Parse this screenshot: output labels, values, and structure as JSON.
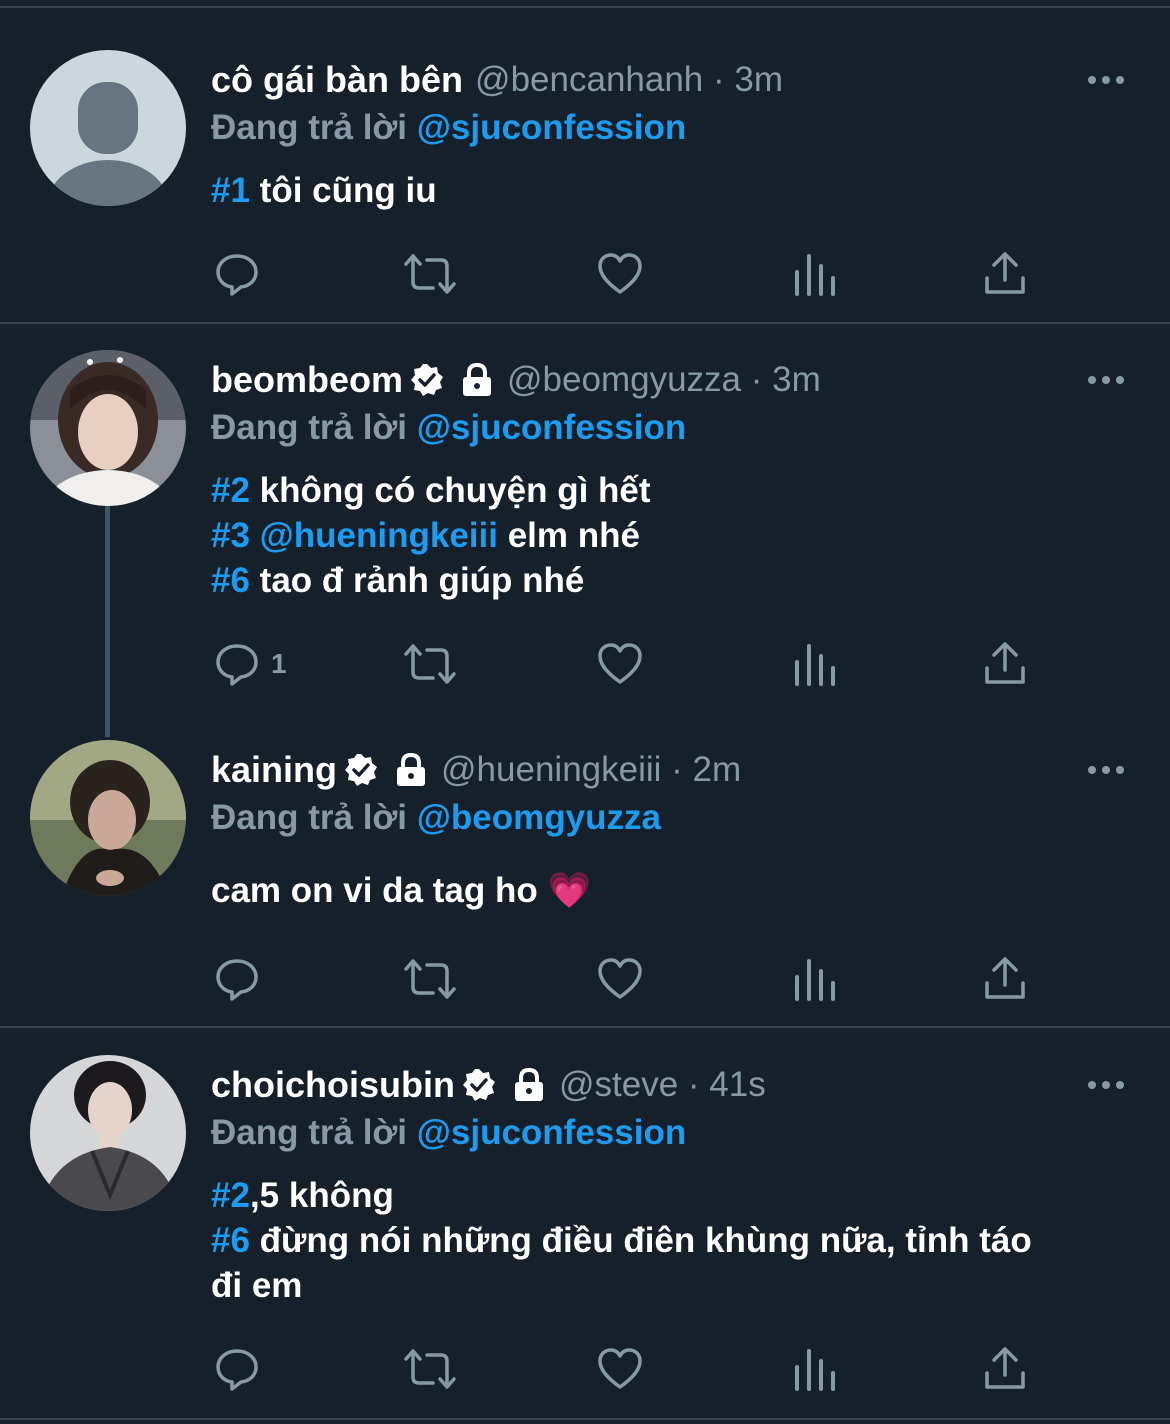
{
  "tweets": [
    {
      "name": "cô gái bàn bên",
      "handle": "@bencanhanh · 3m",
      "reply_prefix": "Đang trả lời ",
      "reply_to": "@sjuconfession",
      "lines": [
        {
          "tag": "#1",
          "text": " tôi cũng iu"
        }
      ],
      "reply_count": ""
    },
    {
      "name": "beombeom",
      "handle": "@beomgyuzza · 3m",
      "reply_prefix": "Đang trả lời ",
      "reply_to": "@sjuconfession",
      "lines": [
        {
          "tag": "#2",
          "text": " không có chuyện gì hết"
        },
        {
          "tag": "#3",
          "mention": " @hueningkeiii",
          "text": " elm nhé"
        },
        {
          "tag": "#6",
          "text": " tao đ rảnh giúp nhé"
        }
      ],
      "reply_count": "1"
    },
    {
      "name": "kaining",
      "handle": "@hueningkeiii · 2m",
      "reply_prefix": "Đang trả lời ",
      "reply_to": "@beomgyuzza",
      "lines": [
        {
          "text": "cam on vi da tag ho ",
          "emoji": "💗"
        }
      ],
      "reply_count": ""
    },
    {
      "name": "choichoisubin",
      "handle": "@steve · 41s",
      "reply_prefix": "Đang trả lời ",
      "reply_to": "@sjuconfession",
      "lines": [
        {
          "tag": "#2",
          "text": ",5 không"
        },
        {
          "tag": "#6",
          "text": " đừng nói những điều điên khùng nữa, tỉnh táo"
        },
        {
          "text": "đi em"
        }
      ],
      "reply_count": ""
    }
  ],
  "icons": {
    "reply": "reply-icon",
    "retweet": "retweet-icon",
    "like": "heart-icon",
    "analytics": "analytics-icon",
    "share": "share-icon",
    "more": "more-icon",
    "verified": "verified-badge-icon",
    "protected": "lock-icon"
  },
  "colors": {
    "background": "#15202b",
    "accent": "#1d9bf0",
    "muted": "#8899a6",
    "divider": "#38444d"
  }
}
